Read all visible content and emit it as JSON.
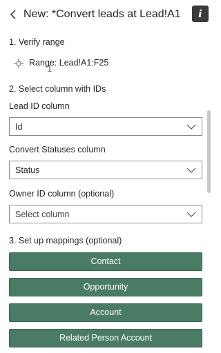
{
  "header": {
    "title": "New: *Convert leads at Lead!A1",
    "info_label": "i"
  },
  "step1": {
    "title": "1. Verify range",
    "range_text": "Range: Lead!A1:F25"
  },
  "step2": {
    "title": "2. Select column with IDs",
    "lead_id": {
      "label": "Lead ID column",
      "value": "Id"
    },
    "convert_status": {
      "label": "Convert Statuses column",
      "value": "Status"
    },
    "owner_id": {
      "label": "Owner ID column (optional)",
      "value": "Select column"
    }
  },
  "step3": {
    "title": "3. Set up mappings (optional)",
    "buttons": [
      "Contact",
      "Opportunity",
      "Account",
      "Related Person Account"
    ]
  },
  "colors": {
    "accent_button": "#4a7c65",
    "text": "#252525"
  }
}
